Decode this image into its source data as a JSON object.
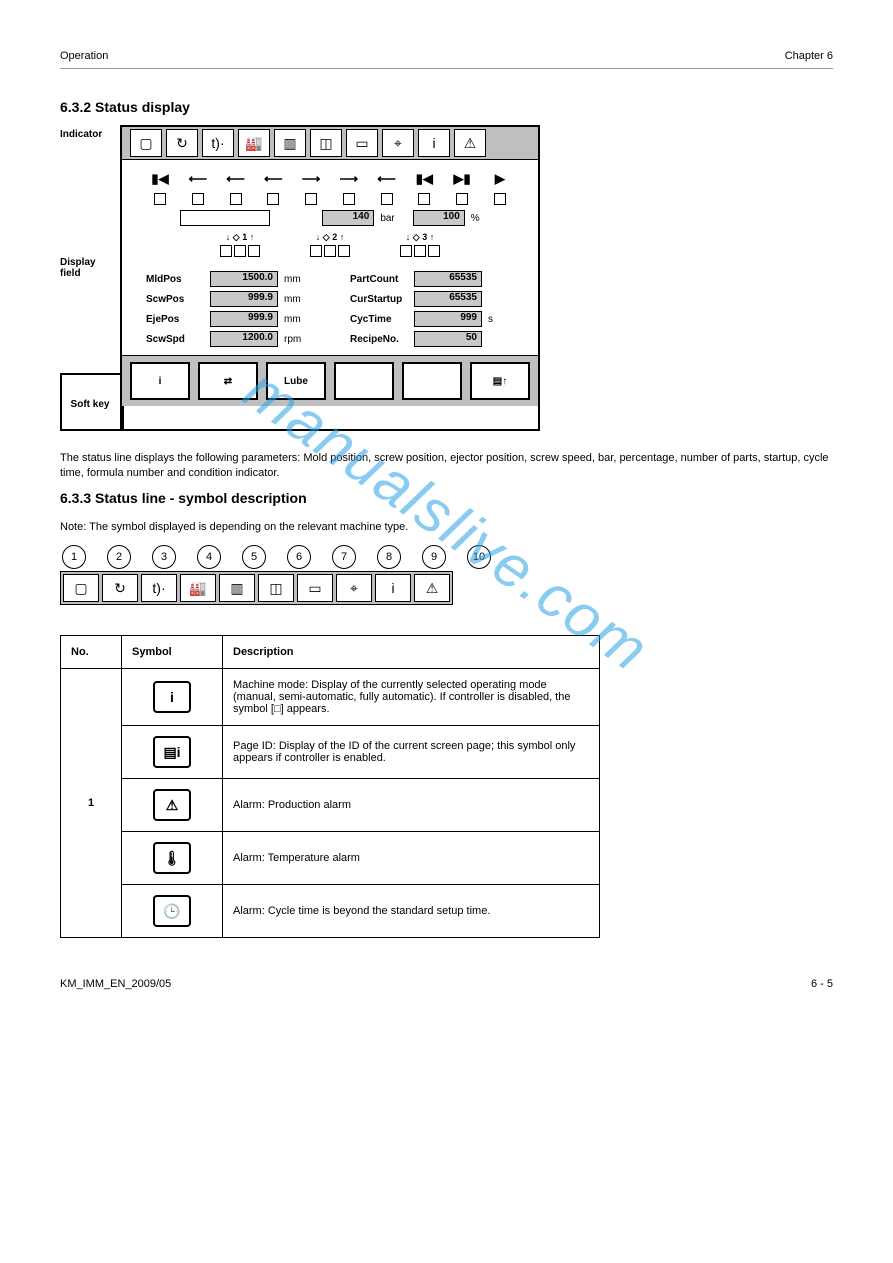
{
  "header": {
    "left": "Operation",
    "right": "Chapter 6"
  },
  "section1_title": "6.3.2 Status display",
  "side_labels": {
    "indicator": "Indicator",
    "display": "Display field",
    "softkey": "Soft key"
  },
  "display": {
    "pressure_value": "140",
    "pressure_unit": "bar",
    "percent_value": "100",
    "percent_unit": "%",
    "dropsets": [
      "1",
      "2",
      "3"
    ],
    "info_left": [
      {
        "label": "MldPos",
        "value": "1500.0",
        "unit": "mm"
      },
      {
        "label": "ScwPos",
        "value": "999.9",
        "unit": "mm"
      },
      {
        "label": "EjePos",
        "value": "999.9",
        "unit": "mm"
      },
      {
        "label": "ScwSpd",
        "value": "1200.0",
        "unit": "rpm"
      }
    ],
    "info_right": [
      {
        "label": "PartCount",
        "value": "65535",
        "unit": ""
      },
      {
        "label": "CurStartup",
        "value": "65535",
        "unit": ""
      },
      {
        "label": "CycTime",
        "value": "999",
        "unit": "s"
      },
      {
        "label": "RecipeNo.",
        "value": "50",
        "unit": ""
      }
    ]
  },
  "softkeys": [
    "i",
    "⇄",
    "Lube",
    "",
    "",
    "▤↑"
  ],
  "after_screenshot_text": "The status line displays the following parameters: Mold position, screw position, ejector position, screw speed, bar, percentage, number of parts, startup, cycle time, formula number and condition indicator.",
  "section2_title": "6.3.3 Status line - symbol description",
  "note_text": "Note: The symbol displayed is depending on the relevant machine type.",
  "indicator_numbers": [
    "1",
    "2",
    "3",
    "4",
    "5",
    "6",
    "7",
    "8",
    "9",
    "10"
  ],
  "sym_table": {
    "headers": [
      "No.",
      "Symbol",
      "Description"
    ],
    "rows": [
      {
        "no": "1",
        "icon": "i",
        "desc": "Machine mode: Display of the currently selected operating mode (manual, semi-automatic, fully automatic).\nIf controller is disabled, the symbol [□] appears."
      },
      {
        "no": "1",
        "icon": "▤i",
        "desc": "Page ID: Display of the ID of the current screen page; this symbol only appears if controller is enabled."
      },
      {
        "no": "1",
        "icon": "⚠",
        "desc": "Alarm: Production alarm"
      },
      {
        "no": "1",
        "icon": "🌡",
        "desc": "Alarm: Temperature alarm"
      },
      {
        "no": "1",
        "icon": "🕒",
        "desc": "Alarm: Cycle time is beyond the standard setup time."
      }
    ]
  },
  "footer": {
    "left": "KM_IMM_EN_2009/05",
    "right": "6 - 5"
  },
  "watermark": "manualslive.com"
}
